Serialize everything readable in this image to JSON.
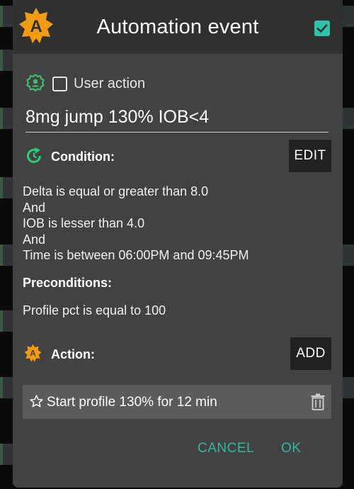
{
  "dialog": {
    "title": "Automation event",
    "enabled_checked": true,
    "logo_letter": "A"
  },
  "user_action": {
    "icon": "user-gear-icon",
    "checked": false,
    "label": "User action"
  },
  "event_name": {
    "value": "8mg jump 130% IOB<4"
  },
  "condition": {
    "icon": "refresh-icon",
    "label": "Condition:",
    "edit_label": "EDIT",
    "lines": [
      "Delta is equal or greater than 8.0",
      "And",
      "IOB is lesser than 4.0",
      "And",
      "Time is between 06:00PM and 09:45PM"
    ]
  },
  "preconditions": {
    "label": "Preconditions:",
    "lines": [
      "Profile pct is equal to 100"
    ]
  },
  "action": {
    "icon": "app-logo-icon",
    "label": "Action:",
    "add_label": "ADD",
    "items": [
      {
        "icon": "star-outline-icon",
        "text": "Start profile 130% for 12 min",
        "delete_icon": "trash-icon"
      }
    ]
  },
  "buttons": {
    "cancel": "CANCEL",
    "ok": "OK"
  },
  "colors": {
    "dialog_bg": "#424242",
    "header_bg": "#303030",
    "accent_teal": "#2dc3ae",
    "logo_orange": "#f39c12",
    "condition_green": "#2ecc71",
    "button_dark": "#212121",
    "action_row_bg": "#5b5b5b"
  }
}
